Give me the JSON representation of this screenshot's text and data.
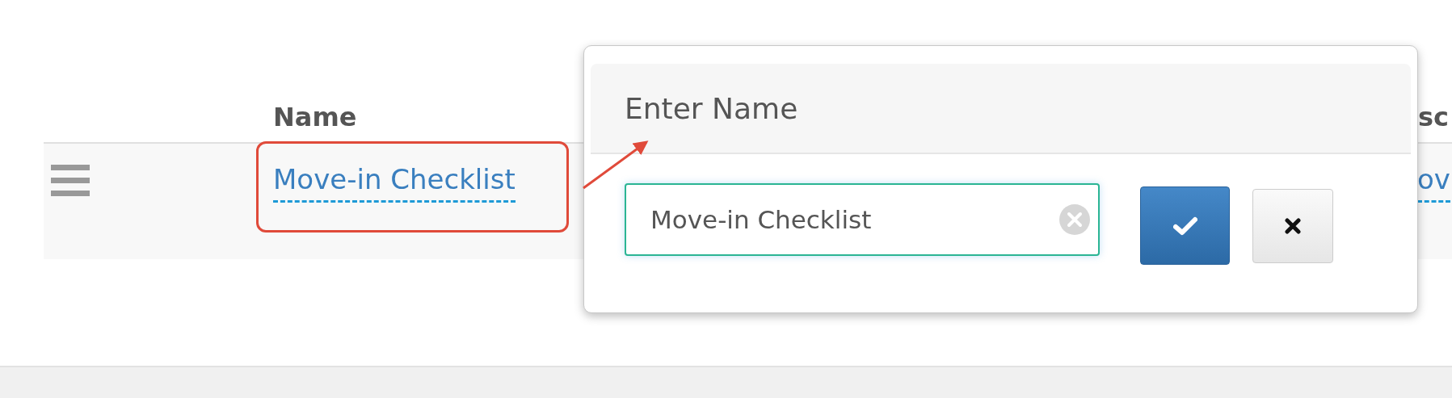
{
  "table": {
    "columns": [
      {
        "label": "Name"
      },
      {
        "label": "sc"
      }
    ],
    "rows": [
      {
        "name": "Move-in Checklist",
        "column_2": "ov"
      }
    ]
  },
  "popover": {
    "title": "Enter Name",
    "input": {
      "value": "Move-in Checklist"
    },
    "buttons": [
      {
        "kind": "confirm"
      },
      {
        "kind": "cancel"
      }
    ]
  }
}
